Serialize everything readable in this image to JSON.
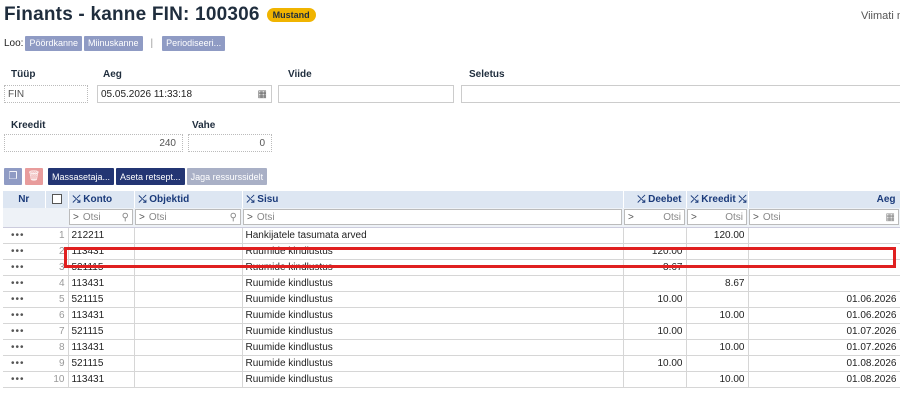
{
  "header": {
    "title": "Finants - kanne FIN: 100306",
    "status_badge": "Mustand",
    "viimati": "Viimati m"
  },
  "create": {
    "label": "Loo:",
    "buttons": [
      "Pöördkanne",
      "Miinuskanne"
    ],
    "periodize": "Periodiseeri..."
  },
  "fields": {
    "tyyp": {
      "label": "Tüüp",
      "value": "FIN"
    },
    "aeg": {
      "label": "Aeg",
      "value": "05.05.2026 11:33:18"
    },
    "viide": {
      "label": "Viide",
      "value": ""
    },
    "seletus": {
      "label": "Seletus",
      "value": ""
    },
    "kreedit": {
      "label": "Kreedit",
      "value": "240"
    },
    "vahe": {
      "label": "Vahe",
      "value": "0"
    }
  },
  "toolbar": {
    "massasetaja": "Massasetaja...",
    "aseta_retsept": "Aseta retsept...",
    "jaga": "Jaga ressurssidelt"
  },
  "columns": {
    "nr": "Nr",
    "konto": "Konto",
    "objektid": "Objektid",
    "sisu": "Sisu",
    "deebet": "Deebet",
    "kreedit": "Kreedit",
    "aeg": "Aeg"
  },
  "filter": {
    "placeholder": "Otsi"
  },
  "rows": [
    {
      "nr": "1",
      "konto": "212211",
      "objektid": "",
      "sisu": "Hankijatele tasumata arved",
      "deebet": "",
      "kreedit": "120.00",
      "aeg": ""
    },
    {
      "nr": "2",
      "konto": "113431",
      "objektid": "",
      "sisu": "Ruumide kindlustus",
      "deebet": "120.00",
      "kreedit": "",
      "aeg": ""
    },
    {
      "nr": "3",
      "konto": "521115",
      "objektid": "",
      "sisu": "Ruumide kindlustus",
      "deebet": "8.67",
      "kreedit": "",
      "aeg": ""
    },
    {
      "nr": "4",
      "konto": "113431",
      "objektid": "",
      "sisu": "Ruumide kindlustus",
      "deebet": "",
      "kreedit": "8.67",
      "aeg": ""
    },
    {
      "nr": "5",
      "konto": "521115",
      "objektid": "",
      "sisu": "Ruumide kindlustus",
      "deebet": "10.00",
      "kreedit": "",
      "aeg": "01.06.2026"
    },
    {
      "nr": "6",
      "konto": "113431",
      "objektid": "",
      "sisu": "Ruumide kindlustus",
      "deebet": "",
      "kreedit": "10.00",
      "aeg": "01.06.2026"
    },
    {
      "nr": "7",
      "konto": "521115",
      "objektid": "",
      "sisu": "Ruumide kindlustus",
      "deebet": "10.00",
      "kreedit": "",
      "aeg": "01.07.2026"
    },
    {
      "nr": "8",
      "konto": "113431",
      "objektid": "",
      "sisu": "Ruumide kindlustus",
      "deebet": "",
      "kreedit": "10.00",
      "aeg": "01.07.2026"
    },
    {
      "nr": "9",
      "konto": "521115",
      "objektid": "",
      "sisu": "Ruumide kindlustus",
      "deebet": "10.00",
      "kreedit": "",
      "aeg": "01.08.2026"
    },
    {
      "nr": "10",
      "konto": "113431",
      "objektid": "",
      "sisu": "Ruumide kindlustus",
      "deebet": "",
      "kreedit": "10.00",
      "aeg": "01.08.2026"
    }
  ],
  "icons": {
    "row_menu": "row-menu-icon",
    "copy": "copy-icon",
    "delete": "trash-icon",
    "pin": "pin-icon",
    "calendar": "calendar-icon",
    "search": "search-icon"
  },
  "colors": {
    "badge": "#f0b400",
    "highlight": "#e02020",
    "header_bg": "#dde6f2",
    "button": "#233573"
  }
}
